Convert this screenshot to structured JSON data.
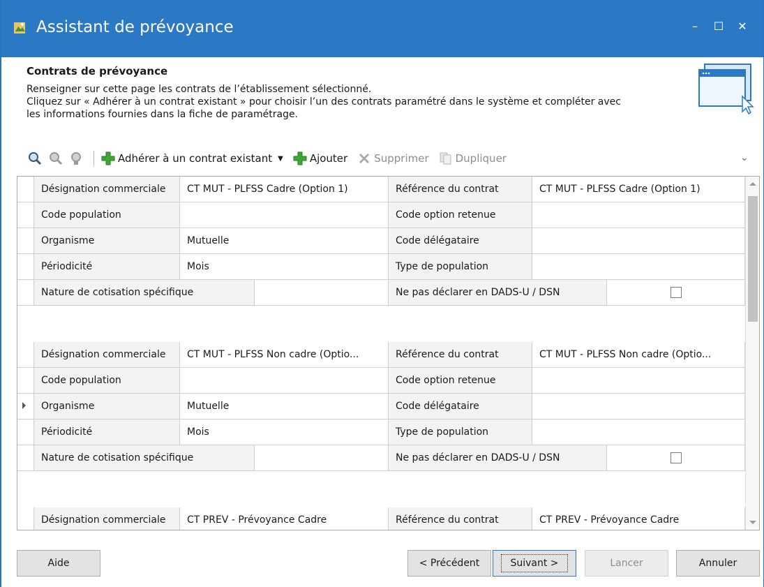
{
  "window": {
    "title": "Assistant de prévoyance",
    "controls": {
      "minimize": "–",
      "maximize": "☐",
      "close": "✕"
    }
  },
  "header": {
    "title": "Contrats de prévoyance",
    "description": "Renseigner sur cette page les contrats de l’établissement sélectionné.\nCliquez sur « Adhérer à un contrat existant » pour choisir l’un des contrats paramétré dans le système et compléter avec\nles informations fournies dans la fiche de paramétrage."
  },
  "toolbar": {
    "adherer": "Adhérer à un contrat existant",
    "ajouter": "Ajouter",
    "supprimer": "Supprimer",
    "dupliquer": "Dupliquer",
    "chevron": "⌄"
  },
  "labels": {
    "designation": "Désignation commerciale",
    "reference": "Référence du contrat",
    "code_population": "Code population",
    "code_option": "Code option retenue",
    "organisme": "Organisme",
    "code_delegataire": "Code délégataire",
    "periodicite": "Périodicité",
    "type_population": "Type de population",
    "nature": "Nature de cotisation spécifique",
    "ne_pas_declarer": "Ne pas déclarer en DADS-U / DSN"
  },
  "contracts": [
    {
      "designation": "CT MUT - PLFSS Cadre (Option 1)",
      "reference": "CT MUT - PLFSS Cadre (Option 1)",
      "code_population": "",
      "code_option": "",
      "organisme": "Mutuelle",
      "code_delegataire": "",
      "periodicite": "Mois",
      "type_population": "",
      "nature": "",
      "ne_pas_declarer": false
    },
    {
      "designation": "CT MUT - PLFSS Non cadre (Optio...",
      "reference": "CT MUT - PLFSS Non cadre (Optio...",
      "code_population": "",
      "code_option": "",
      "organisme": "Mutuelle",
      "code_delegataire": "",
      "periodicite": "Mois",
      "type_population": "",
      "nature": "",
      "ne_pas_declarer": false
    },
    {
      "designation": "CT PREV - Prévoyance Cadre",
      "reference": "CT PREV - Prévoyance Cadre"
    }
  ],
  "footer": {
    "aide": "Aide",
    "precedent": "< Précédent",
    "suivant": "Suivant >",
    "lancer": "Lancer",
    "annuler": "Annuler"
  },
  "colors": {
    "titlebar": "#2b79c4",
    "plus_icon": "#3fa535",
    "disabled_text": "#8e8e8e"
  }
}
